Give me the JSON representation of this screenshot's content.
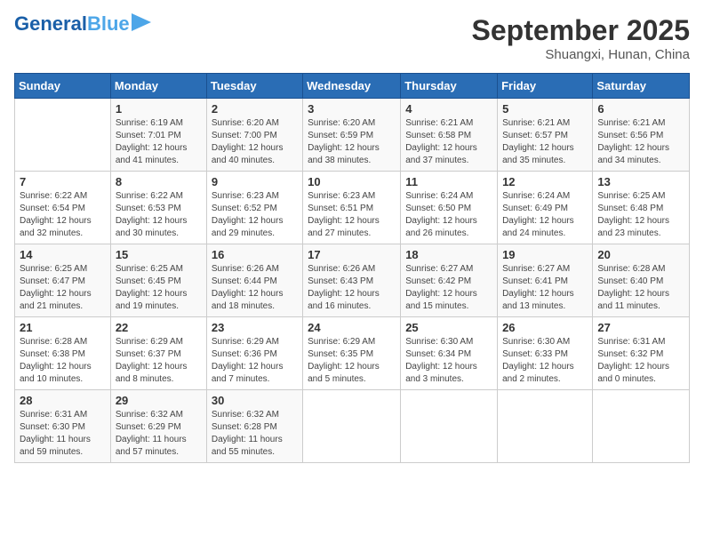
{
  "header": {
    "logo_general": "General",
    "logo_blue": "Blue",
    "month": "September 2025",
    "location": "Shuangxi, Hunan, China"
  },
  "days_of_week": [
    "Sunday",
    "Monday",
    "Tuesday",
    "Wednesday",
    "Thursday",
    "Friday",
    "Saturday"
  ],
  "weeks": [
    [
      {
        "day": "",
        "info": ""
      },
      {
        "day": "1",
        "info": "Sunrise: 6:19 AM\nSunset: 7:01 PM\nDaylight: 12 hours\nand 41 minutes."
      },
      {
        "day": "2",
        "info": "Sunrise: 6:20 AM\nSunset: 7:00 PM\nDaylight: 12 hours\nand 40 minutes."
      },
      {
        "day": "3",
        "info": "Sunrise: 6:20 AM\nSunset: 6:59 PM\nDaylight: 12 hours\nand 38 minutes."
      },
      {
        "day": "4",
        "info": "Sunrise: 6:21 AM\nSunset: 6:58 PM\nDaylight: 12 hours\nand 37 minutes."
      },
      {
        "day": "5",
        "info": "Sunrise: 6:21 AM\nSunset: 6:57 PM\nDaylight: 12 hours\nand 35 minutes."
      },
      {
        "day": "6",
        "info": "Sunrise: 6:21 AM\nSunset: 6:56 PM\nDaylight: 12 hours\nand 34 minutes."
      }
    ],
    [
      {
        "day": "7",
        "info": "Sunrise: 6:22 AM\nSunset: 6:54 PM\nDaylight: 12 hours\nand 32 minutes."
      },
      {
        "day": "8",
        "info": "Sunrise: 6:22 AM\nSunset: 6:53 PM\nDaylight: 12 hours\nand 30 minutes."
      },
      {
        "day": "9",
        "info": "Sunrise: 6:23 AM\nSunset: 6:52 PM\nDaylight: 12 hours\nand 29 minutes."
      },
      {
        "day": "10",
        "info": "Sunrise: 6:23 AM\nSunset: 6:51 PM\nDaylight: 12 hours\nand 27 minutes."
      },
      {
        "day": "11",
        "info": "Sunrise: 6:24 AM\nSunset: 6:50 PM\nDaylight: 12 hours\nand 26 minutes."
      },
      {
        "day": "12",
        "info": "Sunrise: 6:24 AM\nSunset: 6:49 PM\nDaylight: 12 hours\nand 24 minutes."
      },
      {
        "day": "13",
        "info": "Sunrise: 6:25 AM\nSunset: 6:48 PM\nDaylight: 12 hours\nand 23 minutes."
      }
    ],
    [
      {
        "day": "14",
        "info": "Sunrise: 6:25 AM\nSunset: 6:47 PM\nDaylight: 12 hours\nand 21 minutes."
      },
      {
        "day": "15",
        "info": "Sunrise: 6:25 AM\nSunset: 6:45 PM\nDaylight: 12 hours\nand 19 minutes."
      },
      {
        "day": "16",
        "info": "Sunrise: 6:26 AM\nSunset: 6:44 PM\nDaylight: 12 hours\nand 18 minutes."
      },
      {
        "day": "17",
        "info": "Sunrise: 6:26 AM\nSunset: 6:43 PM\nDaylight: 12 hours\nand 16 minutes."
      },
      {
        "day": "18",
        "info": "Sunrise: 6:27 AM\nSunset: 6:42 PM\nDaylight: 12 hours\nand 15 minutes."
      },
      {
        "day": "19",
        "info": "Sunrise: 6:27 AM\nSunset: 6:41 PM\nDaylight: 12 hours\nand 13 minutes."
      },
      {
        "day": "20",
        "info": "Sunrise: 6:28 AM\nSunset: 6:40 PM\nDaylight: 12 hours\nand 11 minutes."
      }
    ],
    [
      {
        "day": "21",
        "info": "Sunrise: 6:28 AM\nSunset: 6:38 PM\nDaylight: 12 hours\nand 10 minutes."
      },
      {
        "day": "22",
        "info": "Sunrise: 6:29 AM\nSunset: 6:37 PM\nDaylight: 12 hours\nand 8 minutes."
      },
      {
        "day": "23",
        "info": "Sunrise: 6:29 AM\nSunset: 6:36 PM\nDaylight: 12 hours\nand 7 minutes."
      },
      {
        "day": "24",
        "info": "Sunrise: 6:29 AM\nSunset: 6:35 PM\nDaylight: 12 hours\nand 5 minutes."
      },
      {
        "day": "25",
        "info": "Sunrise: 6:30 AM\nSunset: 6:34 PM\nDaylight: 12 hours\nand 3 minutes."
      },
      {
        "day": "26",
        "info": "Sunrise: 6:30 AM\nSunset: 6:33 PM\nDaylight: 12 hours\nand 2 minutes."
      },
      {
        "day": "27",
        "info": "Sunrise: 6:31 AM\nSunset: 6:32 PM\nDaylight: 12 hours\nand 0 minutes."
      }
    ],
    [
      {
        "day": "28",
        "info": "Sunrise: 6:31 AM\nSunset: 6:30 PM\nDaylight: 11 hours\nand 59 minutes."
      },
      {
        "day": "29",
        "info": "Sunrise: 6:32 AM\nSunset: 6:29 PM\nDaylight: 11 hours\nand 57 minutes."
      },
      {
        "day": "30",
        "info": "Sunrise: 6:32 AM\nSunset: 6:28 PM\nDaylight: 11 hours\nand 55 minutes."
      },
      {
        "day": "",
        "info": ""
      },
      {
        "day": "",
        "info": ""
      },
      {
        "day": "",
        "info": ""
      },
      {
        "day": "",
        "info": ""
      }
    ]
  ]
}
